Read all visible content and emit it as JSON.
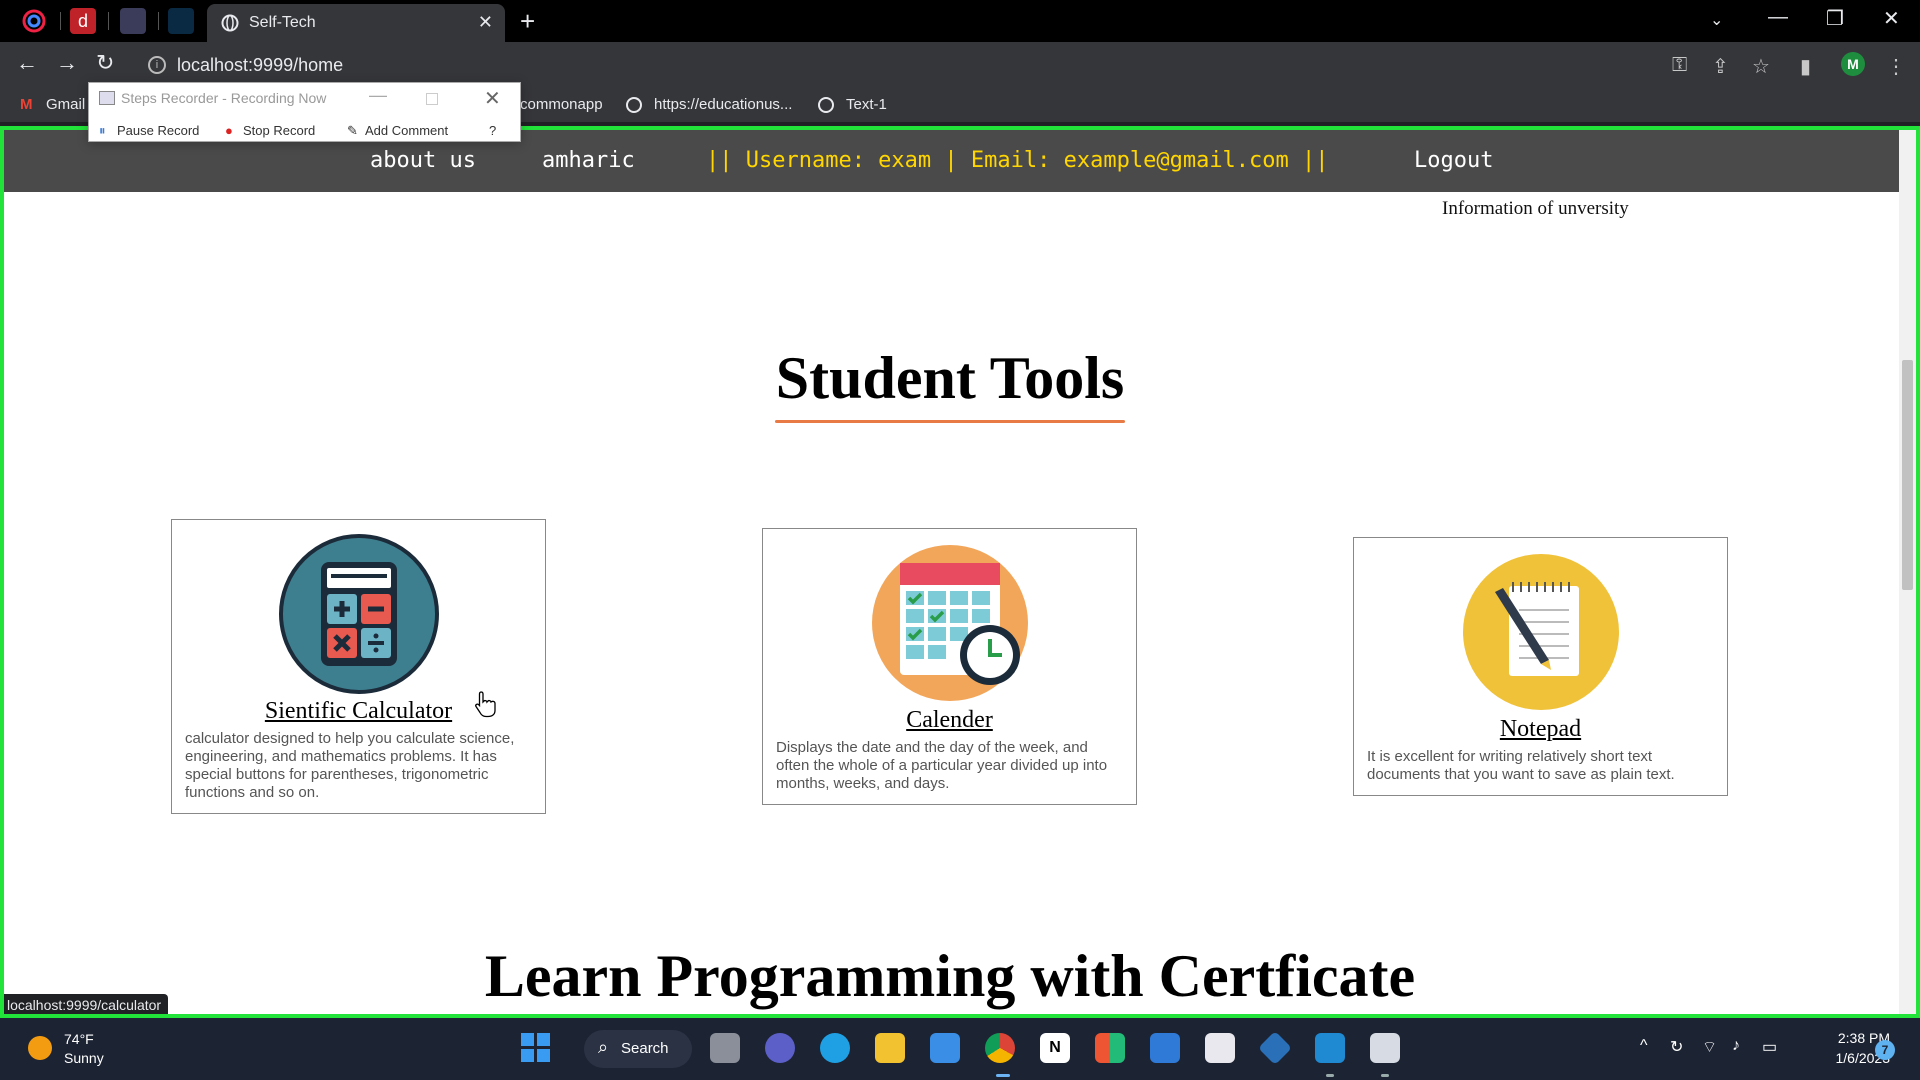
{
  "browser": {
    "active_tab_title": "Self-Tech",
    "url": "localhost:9999/home",
    "bookmarks": [
      "Gmail",
      "commonapp",
      "https://educationus...",
      "Text-1"
    ],
    "profile_initial": "M",
    "status_tooltip": "localhost:9999/calculator"
  },
  "recorder": {
    "title": "Steps Recorder - Recording Now",
    "pause": "Pause Record",
    "stop": "Stop Record",
    "comment": "Add Comment"
  },
  "site_nav": {
    "about": "about us",
    "amharic": "amharic",
    "user_info": "|| Username: exam | Email: example@gmail.com ||",
    "logout": "Logout"
  },
  "info_text": "Information of unversity",
  "tools_heading": "Student Tools",
  "tools": [
    {
      "title": "Sientific Calculator",
      "description": "calculator designed to help you calculate science, engineering, and mathematics problems. It has special buttons for parentheses, trigonometric functions and so on."
    },
    {
      "title": "Calender",
      "description": "Displays the date and the day of the week, and often the whole of a particular year divided up into months, weeks, and days."
    },
    {
      "title": "Notepad",
      "description": "It is excellent for writing relatively short text documents that you want to save as plain text."
    }
  ],
  "programming_heading": "Learn Programming with Certficate",
  "taskbar": {
    "temp": "74°F",
    "weather": "Sunny",
    "search": "Search",
    "time": "2:38 PM",
    "date": "1/6/2023",
    "notifications": "7"
  },
  "colors": {
    "accent_underline": "#e87b45",
    "nav_bg": "#4a4a4a",
    "user_info": "#ffd600",
    "frame": "#22e33a"
  }
}
